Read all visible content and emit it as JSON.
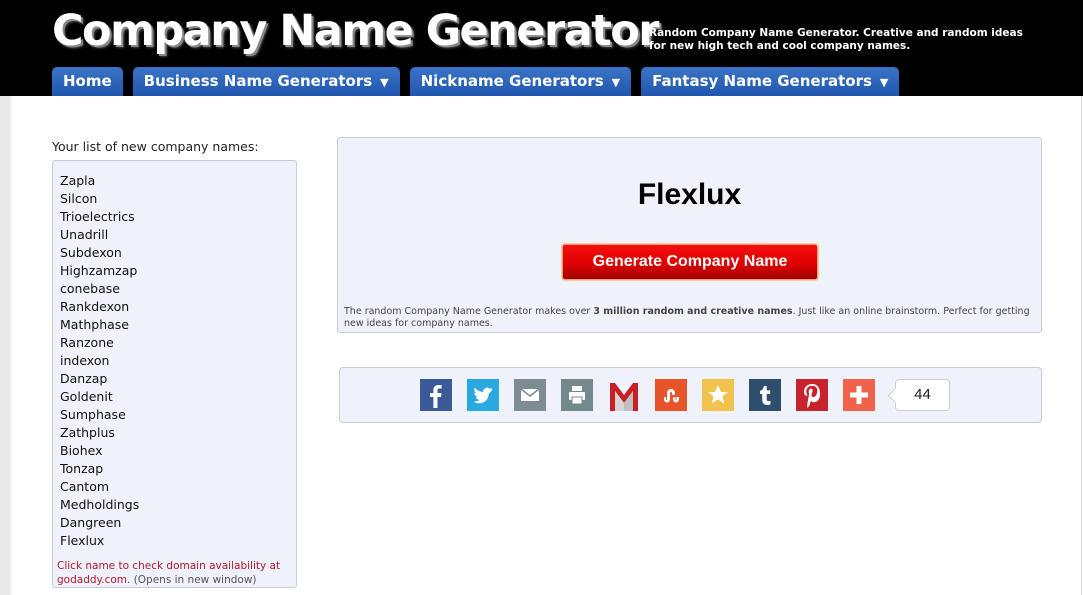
{
  "header": {
    "title": "Company Name Generator",
    "tagline": "Random Company Name Generator. Creative and random ideas for new high tech and cool company names."
  },
  "nav": {
    "tabs": [
      {
        "label": "Home",
        "has_dropdown": false
      },
      {
        "label": "Business Name Generators",
        "has_dropdown": true
      },
      {
        "label": "Nickname Generators",
        "has_dropdown": true
      },
      {
        "label": "Fantasy Name Generators",
        "has_dropdown": true
      }
    ],
    "dropdown_glyph": "▼"
  },
  "name_list": {
    "label": "Your list of new company names:",
    "names": [
      "Zapla",
      "Silcon",
      "Trioelectrics",
      "Unadrill",
      "Subdexon",
      "Highzamzap",
      "conebase",
      "Rankdexon",
      "Mathphase",
      "Ranzone",
      "indexon",
      "Danzap",
      "Goldenit",
      "Sumphase",
      "Zathplus",
      "Biohex",
      "Tonzap",
      "Cantom",
      "Medholdings",
      "Dangreen",
      "Flexlux"
    ],
    "note_link": "Click name to check domain availability at godaddy.com.",
    "note_extra": "(Opens in new window)"
  },
  "generator": {
    "current_name": "Flexlux",
    "button_label": "Generate Company Name",
    "desc_before": "The random Company Name Generator makes over ",
    "desc_bold": "3 million random and creative names",
    "desc_after": ". Just like an online brainstorm. Perfect for getting new ideas for company names."
  },
  "share": {
    "icons": [
      {
        "name": "facebook-icon",
        "glyph": "f",
        "color": "#3b5998"
      },
      {
        "name": "twitter-icon",
        "glyph": "🐦",
        "color": "#29a9e0"
      },
      {
        "name": "email-icon",
        "glyph": "✉",
        "color": "#7d8c92"
      },
      {
        "name": "print-icon",
        "glyph": "⎙",
        "color": "#738a8d"
      },
      {
        "name": "gmail-icon",
        "glyph": "M",
        "color": "#e0e0e0"
      },
      {
        "name": "stumbleupon-icon",
        "glyph": "ʃu",
        "color": "#e8542a"
      },
      {
        "name": "favorites-icon",
        "glyph": "★",
        "color": "#f2c24e"
      },
      {
        "name": "tumblr-icon",
        "glyph": "t",
        "color": "#2f4e6e"
      },
      {
        "name": "pinterest-icon",
        "glyph": "P",
        "color": "#c8232c"
      },
      {
        "name": "more-share-icon",
        "glyph": "+",
        "color": "#f0634a"
      }
    ],
    "count": "44"
  }
}
